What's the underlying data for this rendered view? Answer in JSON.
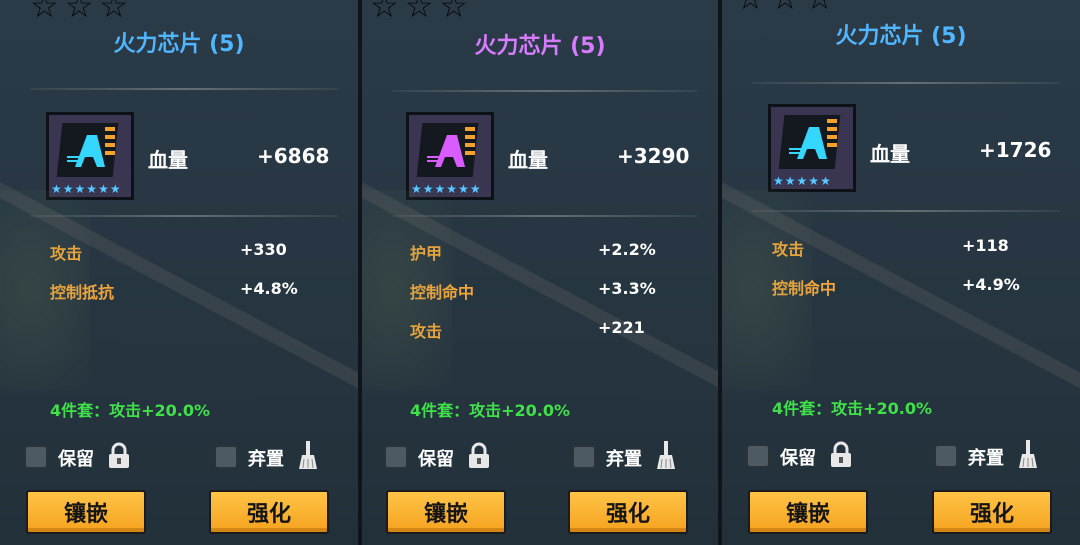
{
  "panels": [
    {
      "title": "火力芯片 (5)",
      "title_color": "#4fb6ff",
      "chip_color": "#35d6ff",
      "rarity_stars": 6,
      "main_stat": {
        "name": "血量",
        "value": "+6868"
      },
      "sub_stats": [
        {
          "name": "攻击",
          "value": "+330"
        },
        {
          "name": "控制抵抗",
          "value": "+4.8%"
        }
      ],
      "set_bonus": "4件套：攻击+20.0%",
      "keep_label": "保留",
      "discard_label": "弃置",
      "inlay_button": "镶嵌",
      "enhance_button": "强化"
    },
    {
      "title": "火力芯片 (5)",
      "title_color": "#d77cff",
      "chip_color": "#d85cff",
      "rarity_stars": 6,
      "main_stat": {
        "name": "血量",
        "value": "+3290"
      },
      "sub_stats": [
        {
          "name": "护甲",
          "value": "+2.2%"
        },
        {
          "name": "控制命中",
          "value": "+3.3%"
        },
        {
          "name": "攻击",
          "value": "+221"
        }
      ],
      "set_bonus": "4件套：攻击+20.0%",
      "keep_label": "保留",
      "discard_label": "弃置",
      "inlay_button": "镶嵌",
      "enhance_button": "强化"
    },
    {
      "title": "火力芯片 (5)",
      "title_color": "#4fb6ff",
      "chip_color": "#35d6ff",
      "rarity_stars": 5,
      "main_stat": {
        "name": "血量",
        "value": "+1726"
      },
      "sub_stats": [
        {
          "name": "攻击",
          "value": "+118"
        },
        {
          "name": "控制命中",
          "value": "+4.9%"
        }
      ],
      "set_bonus": "4件套：攻击+20.0%",
      "keep_label": "保留",
      "discard_label": "弃置",
      "inlay_button": "镶嵌",
      "enhance_button": "强化"
    }
  ]
}
